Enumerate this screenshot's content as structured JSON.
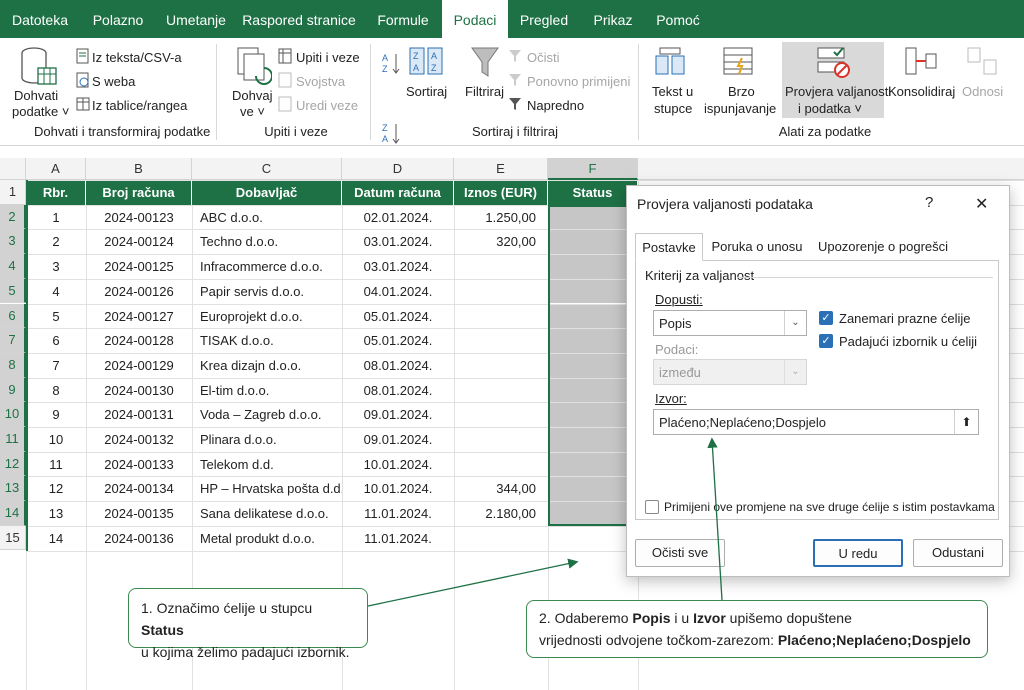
{
  "menu": [
    "Datoteka",
    "Polazno",
    "Umetanje",
    "Raspored stranice",
    "Formule",
    "Podaci",
    "Pregled",
    "Prikaz",
    "Pomoć"
  ],
  "ribbon": {
    "get_data": "Dohvati",
    "get_data2": "podatke",
    "from_text": "Iz teksta/CSV-a",
    "from_web": "S weba",
    "from_table": "Iz tablice/rangea",
    "group1": "Dohvati i transformiraj podatke",
    "refresh": "Dohvaj",
    "refresh2": "ve",
    "queries": "Upiti i veze",
    "properties": "Svojstva",
    "edit_links": "Uredi veze",
    "group2": "Upiti i veze",
    "sort": "Sortiraj",
    "filter": "Filtriraj",
    "clear": "Očisti",
    "reapply": "Ponovno primijeni",
    "advanced": "Napredno",
    "group3": "Sortiraj i filtriraj",
    "text_to_columns": "Tekst u",
    "text_to_columns2": "stupce",
    "flash_fill": "Brzo",
    "flash_fill2": "ispunjavanje",
    "data_validation": "Provjera valjanosti",
    "data_validation2": "i podatka",
    "consolidate": "Konsolidiraj",
    "relationships": "Odnosi",
    "group4": "Alati za podatke"
  },
  "columns": [
    "A",
    "B",
    "C",
    "D",
    "E",
    "F"
  ],
  "table": {
    "headers": [
      "Rbr.",
      "Broj računa",
      "Dobavljač",
      "Datum računa",
      "Iznos (EUR)",
      "Status"
    ],
    "rows": [
      [
        "1",
        "2024-00123",
        "ABC d.o.o.",
        "02.01.2024.",
        "1.250,00"
      ],
      [
        "2",
        "2024-00124",
        "Techno d.o.o.",
        "03.01.2024.",
        "320,00"
      ],
      [
        "3",
        "2024-00125",
        "Infracommerce d.o.o.",
        "03.01.2024.",
        ""
      ],
      [
        "4",
        "2024-00126",
        "Papir servis d.o.o.",
        "04.01.2024.",
        ""
      ],
      [
        "5",
        "2024-00127",
        "Europrojekt d.o.o.",
        "05.01.2024.",
        ""
      ],
      [
        "6",
        "2024-00128",
        "TISAK d.o.o.",
        "05.01.2024.",
        ""
      ],
      [
        "7",
        "2024-00129",
        "Krea dizajn d.o.o.",
        "08.01.2024.",
        ""
      ],
      [
        "8",
        "2024-00130",
        "El-tim d.o.o.",
        "08.01.2024.",
        ""
      ],
      [
        "9",
        "2024-00131",
        "Voda – Zagreb d.o.o.",
        "09.01.2024.",
        ""
      ],
      [
        "10",
        "2024-00132",
        "Plinara d.o.o.",
        "09.01.2024.",
        ""
      ],
      [
        "11",
        "2024-00133",
        "Telekom d.d.",
        "10.01.2024.",
        ""
      ],
      [
        "12",
        "2024-00134",
        "HP – Hrvatska pošta d.d.",
        "10.01.2024.",
        "344,00"
      ],
      [
        "13",
        "2024-00135",
        "Sana delikatese d.o.o.",
        "11.01.2024.",
        "2.180,00"
      ],
      [
        "14",
        "2024-00136",
        "Metal produkt d.o.o.",
        "11.01.2024.",
        ""
      ]
    ]
  },
  "row_numbers": [
    "1",
    "2",
    "3",
    "4",
    "5",
    "6",
    "7",
    "8",
    "9",
    "10",
    "11",
    "12",
    "13",
    "14",
    "15"
  ],
  "dialog": {
    "title": "Provjera valjanosti podataka",
    "help": "?",
    "close": "✕",
    "tabs": [
      "Postavke",
      "Poruka o unosu",
      "Upozorenje o pogrešci"
    ],
    "criteria": "Kriterij za valjanost",
    "allow_label": "Dopusti:",
    "allow_value": "Popis",
    "data_label": "Podaci:",
    "data_value": "između",
    "ignore_blank": "Zanemari prazne ćelije",
    "in_cell_dropdown": "Padajući izbornik u ćeliji",
    "source_label": "Izvor:",
    "source_value": "Plaćeno;Neplaćeno;Dospjelo",
    "apply_all": "Primijeni ove promjene na sve druge ćelije s istim postavkama",
    "clear_all": "Očisti sve",
    "ok": "U redu",
    "cancel": "Odustani"
  },
  "callouts": {
    "c1_a": "1. Označimo ćelije u stupcu ",
    "c1_b": "Status",
    "c1_c": "u kojima želimo padajući izbornik.",
    "c2_a": "2. Odaberemo ",
    "c2_b": "Popis",
    "c2_c": " i u ",
    "c2_d": "Izvor",
    "c2_e": " upišemo dopuštene",
    "c2_f": "vrijednosti odvojene točkom-zarezom: ",
    "c2_g": "Plaćeno;Neplaćeno;Dospjelo"
  },
  "colors": {
    "excel_green": "#1e7145",
    "selection": "#c6c6c6"
  }
}
